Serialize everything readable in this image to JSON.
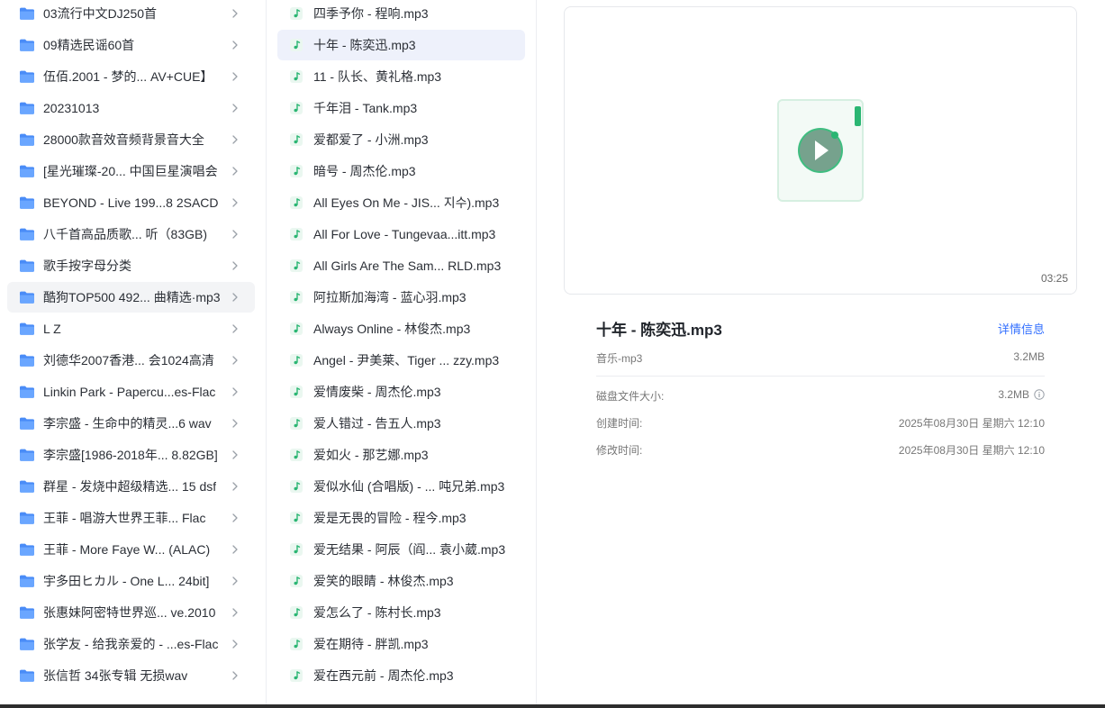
{
  "folders": [
    {
      "label": "03流行中文DJ250首"
    },
    {
      "label": "09精选民谣60首"
    },
    {
      "label": "伍佰.2001 - 梦的...  AV+CUE】"
    },
    {
      "label": "20231013"
    },
    {
      "label": "28000款音效音频背景音大全"
    },
    {
      "label": "[星光璀璨-20...  中国巨星演唱会"
    },
    {
      "label": "BEYOND - Live 199...8 2SACD"
    },
    {
      "label": "八千首高品质歌...  听（83GB)"
    },
    {
      "label": "歌手按字母分类"
    },
    {
      "label": "酷狗TOP500 492... 曲精选·mp3"
    },
    {
      "label": "L Z"
    },
    {
      "label": "刘德华2007香港...  会1024高清"
    },
    {
      "label": "Linkin Park - Papercu...es-Flac"
    },
    {
      "label": "李宗盛 - 生命中的精灵...6  wav"
    },
    {
      "label": "李宗盛[1986-2018年... 8.82GB]"
    },
    {
      "label": "群星 - 发烧中超级精选... 15  dsf"
    },
    {
      "label": "王菲 - 唱游大世界王菲...     Flac"
    },
    {
      "label": "王菲 - More Faye W...  (ALAC)"
    },
    {
      "label": "宇多田ヒカル - One L...  24bit]"
    },
    {
      "label": "张惠妹阿密特世界巡...  ve.2010"
    },
    {
      "label": "张学友 - 给我亲爱的 - ...es-Flac"
    },
    {
      "label": "张信哲 34张专辑 无损wav"
    }
  ],
  "files": [
    {
      "label": "四季予你 - 程响.mp3"
    },
    {
      "label": "十年 - 陈奕迅.mp3"
    },
    {
      "label": "11 - 队长、黄礼格.mp3"
    },
    {
      "label": "千年泪 - Tank.mp3"
    },
    {
      "label": "爱都爱了 - 小洲.mp3"
    },
    {
      "label": "暗号 - 周杰伦.mp3"
    },
    {
      "label": "All Eyes On Me - JIS...  지수).mp3"
    },
    {
      "label": "All For Love - Tungevaa...itt.mp3"
    },
    {
      "label": "All Girls Are The Sam... RLD.mp3"
    },
    {
      "label": "阿拉斯加海湾 - 蓝心羽.mp3"
    },
    {
      "label": "Always Online - 林俊杰.mp3"
    },
    {
      "label": "Angel - 尹美莱、Tiger ... zzy.mp3"
    },
    {
      "label": "爱情废柴 - 周杰伦.mp3"
    },
    {
      "label": "爱人错过 - 告五人.mp3"
    },
    {
      "label": "爱如火 - 那艺娜.mp3"
    },
    {
      "label": "爱似水仙 (合唱版) - ... 吨兄弟.mp3"
    },
    {
      "label": "爱是无畏的冒险 - 程今.mp3"
    },
    {
      "label": "爱无结果 - 阿辰（阎... 袁小葳.mp3"
    },
    {
      "label": "爱笑的眼睛 - 林俊杰.mp3"
    },
    {
      "label": "爱怎么了 - 陈村长.mp3"
    },
    {
      "label": "爱在期待 - 胖凯.mp3"
    },
    {
      "label": "爱在西元前 - 周杰伦.mp3"
    }
  ],
  "preview": {
    "duration": "03:25"
  },
  "info": {
    "title": "十年 - 陈奕迅.mp3",
    "detail_link": "详情信息",
    "type": "音乐-mp3",
    "size": "3.2MB",
    "disk_size_label": "磁盘文件大小:",
    "disk_size": "3.2MB",
    "created_label": "创建时间:",
    "created": "2025年08月30日 星期六 12:10",
    "modified_label": "修改时间:",
    "modified": "2025年08月30日 星期六 12:10"
  },
  "colors": {
    "accent": "#3370ff",
    "folder": "#4a8cf7",
    "music": "#2bb673",
    "selected_bg": "#eef1fb"
  },
  "icons": {
    "folder": "folder-icon",
    "music": "music-note-icon",
    "chevron": "chevron-right-icon",
    "play": "play-icon",
    "info": "info-icon"
  }
}
